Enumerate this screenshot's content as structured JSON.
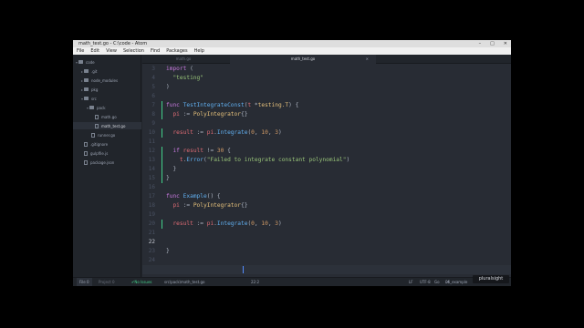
{
  "window": {
    "title": "math_test.go - C:\\code - Atom",
    "controls": [
      "–",
      "□",
      "✕"
    ]
  },
  "menu": [
    "File",
    "Edit",
    "View",
    "Selection",
    "Find",
    "Packages",
    "Help"
  ],
  "tree": [
    {
      "label": "code",
      "type": "folder",
      "icon": "folder-icon"
    },
    {
      "label": ".git",
      "type": "folder",
      "icon": "folder-icon"
    },
    {
      "label": "node_modules",
      "type": "folder",
      "icon": "folder-icon"
    },
    {
      "label": "pkg",
      "type": "folder",
      "icon": "folder-icon"
    },
    {
      "label": "src",
      "type": "folder",
      "icon": "folder-icon"
    },
    {
      "label": "pack",
      "type": "folder",
      "icon": "folder-icon"
    },
    {
      "label": "math.go",
      "type": "file",
      "icon": "file-icon"
    },
    {
      "label": "math_test.go",
      "type": "file",
      "icon": "file-icon",
      "selected": true
    },
    {
      "label": "runner.go",
      "type": "file",
      "icon": "file-icon"
    },
    {
      "label": ".gitignore",
      "type": "file",
      "icon": "file-icon"
    },
    {
      "label": "gulpfile.js",
      "type": "file",
      "icon": "file-icon"
    },
    {
      "label": "package.json",
      "type": "file",
      "icon": "file-icon"
    }
  ],
  "tabs": [
    {
      "label": "math.go",
      "active": false
    },
    {
      "label": "math_test.go",
      "active": true
    }
  ],
  "editor": {
    "lines": [
      {
        "num": "3",
        "tokens": [
          [
            "k",
            "import"
          ],
          [
            "p",
            " ("
          ]
        ]
      },
      {
        "num": "4",
        "tokens": [
          [
            "s",
            "  \"testing\""
          ]
        ]
      },
      {
        "num": "5",
        "tokens": [
          [
            "p",
            ")"
          ]
        ]
      },
      {
        "num": "6",
        "tokens": []
      },
      {
        "num": "7",
        "tokens": [
          [
            "k",
            "func"
          ],
          [
            "p",
            " "
          ],
          [
            "f",
            "TestIntegrateConst"
          ],
          [
            "p",
            "("
          ],
          [
            "v",
            "t"
          ],
          [
            "p",
            " *"
          ],
          [
            "t",
            "testing.T"
          ],
          [
            "p",
            ") {"
          ]
        ]
      },
      {
        "num": "8",
        "tokens": [
          [
            "p",
            "  "
          ],
          [
            "v",
            "pi"
          ],
          [
            "p",
            " := "
          ],
          [
            "t",
            "PolyIntegrator"
          ],
          [
            "p",
            "{}"
          ]
        ]
      },
      {
        "num": "9",
        "tokens": []
      },
      {
        "num": "10",
        "tokens": [
          [
            "p",
            "  "
          ],
          [
            "v",
            "result"
          ],
          [
            "p",
            " := "
          ],
          [
            "v",
            "pi"
          ],
          [
            "p",
            "."
          ],
          [
            "f",
            "Integrate"
          ],
          [
            "p",
            "("
          ],
          [
            "n",
            "0"
          ],
          [
            "p",
            ", "
          ],
          [
            "n",
            "10"
          ],
          [
            "p",
            ", "
          ],
          [
            "n",
            "3"
          ],
          [
            "p",
            ")"
          ]
        ]
      },
      {
        "num": "11",
        "tokens": []
      },
      {
        "num": "12",
        "tokens": [
          [
            "p",
            "  "
          ],
          [
            "k",
            "if"
          ],
          [
            "p",
            " "
          ],
          [
            "v",
            "result"
          ],
          [
            "p",
            " != "
          ],
          [
            "n",
            "30"
          ],
          [
            "p",
            " {"
          ]
        ]
      },
      {
        "num": "13",
        "tokens": [
          [
            "p",
            "    "
          ],
          [
            "v",
            "t"
          ],
          [
            "p",
            "."
          ],
          [
            "f",
            "Error"
          ],
          [
            "p",
            "("
          ],
          [
            "s",
            "\"Failed to integrate constant polynomial\""
          ],
          [
            "p",
            ")"
          ]
        ]
      },
      {
        "num": "14",
        "tokens": [
          [
            "p",
            "  }"
          ]
        ]
      },
      {
        "num": "15",
        "tokens": [
          [
            "p",
            "}"
          ]
        ]
      },
      {
        "num": "16",
        "tokens": []
      },
      {
        "num": "17",
        "tokens": [
          [
            "k",
            "func"
          ],
          [
            "p",
            " "
          ],
          [
            "f",
            "Example"
          ],
          [
            "p",
            "() {"
          ]
        ]
      },
      {
        "num": "18",
        "tokens": [
          [
            "p",
            "  "
          ],
          [
            "v",
            "pi"
          ],
          [
            "p",
            " := "
          ],
          [
            "t",
            "PolyIntegrator"
          ],
          [
            "p",
            "{}"
          ]
        ]
      },
      {
        "num": "19",
        "tokens": []
      },
      {
        "num": "20",
        "tokens": [
          [
            "p",
            "  "
          ],
          [
            "v",
            "result"
          ],
          [
            "p",
            " := "
          ],
          [
            "v",
            "pi"
          ],
          [
            "p",
            "."
          ],
          [
            "f",
            "Integrate"
          ],
          [
            "p",
            "("
          ],
          [
            "n",
            "0"
          ],
          [
            "p",
            ", "
          ],
          [
            "n",
            "10"
          ],
          [
            "p",
            ", "
          ],
          [
            "n",
            "3"
          ],
          [
            "p",
            ")"
          ]
        ]
      },
      {
        "num": "21",
        "tokens": []
      },
      {
        "num": "22",
        "tokens": [],
        "current": true
      },
      {
        "num": "23",
        "tokens": [
          [
            "p",
            "}"
          ]
        ]
      },
      {
        "num": "24",
        "tokens": []
      }
    ]
  },
  "status": {
    "file_btn": "File 0",
    "project_btn": "Project 0",
    "issues": "No Issues",
    "path": "src\\pack\\math_test.go",
    "position": "22:2",
    "lf": "LF",
    "encoding": "UTF-8",
    "grammar": "Go",
    "branch": "06_example"
  },
  "watermark": "pluralsight"
}
